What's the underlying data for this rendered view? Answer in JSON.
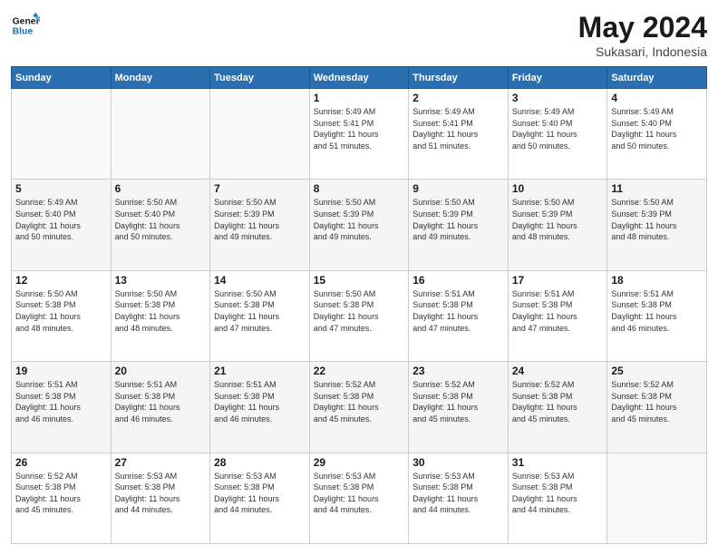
{
  "header": {
    "logo_line1": "General",
    "logo_line2": "Blue",
    "month": "May 2024",
    "location": "Sukasari, Indonesia"
  },
  "weekdays": [
    "Sunday",
    "Monday",
    "Tuesday",
    "Wednesday",
    "Thursday",
    "Friday",
    "Saturday"
  ],
  "weeks": [
    [
      {
        "day": "",
        "info": ""
      },
      {
        "day": "",
        "info": ""
      },
      {
        "day": "",
        "info": ""
      },
      {
        "day": "1",
        "info": "Sunrise: 5:49 AM\nSunset: 5:41 PM\nDaylight: 11 hours\nand 51 minutes."
      },
      {
        "day": "2",
        "info": "Sunrise: 5:49 AM\nSunset: 5:41 PM\nDaylight: 11 hours\nand 51 minutes."
      },
      {
        "day": "3",
        "info": "Sunrise: 5:49 AM\nSunset: 5:40 PM\nDaylight: 11 hours\nand 50 minutes."
      },
      {
        "day": "4",
        "info": "Sunrise: 5:49 AM\nSunset: 5:40 PM\nDaylight: 11 hours\nand 50 minutes."
      }
    ],
    [
      {
        "day": "5",
        "info": "Sunrise: 5:49 AM\nSunset: 5:40 PM\nDaylight: 11 hours\nand 50 minutes."
      },
      {
        "day": "6",
        "info": "Sunrise: 5:50 AM\nSunset: 5:40 PM\nDaylight: 11 hours\nand 50 minutes."
      },
      {
        "day": "7",
        "info": "Sunrise: 5:50 AM\nSunset: 5:39 PM\nDaylight: 11 hours\nand 49 minutes."
      },
      {
        "day": "8",
        "info": "Sunrise: 5:50 AM\nSunset: 5:39 PM\nDaylight: 11 hours\nand 49 minutes."
      },
      {
        "day": "9",
        "info": "Sunrise: 5:50 AM\nSunset: 5:39 PM\nDaylight: 11 hours\nand 49 minutes."
      },
      {
        "day": "10",
        "info": "Sunrise: 5:50 AM\nSunset: 5:39 PM\nDaylight: 11 hours\nand 48 minutes."
      },
      {
        "day": "11",
        "info": "Sunrise: 5:50 AM\nSunset: 5:39 PM\nDaylight: 11 hours\nand 48 minutes."
      }
    ],
    [
      {
        "day": "12",
        "info": "Sunrise: 5:50 AM\nSunset: 5:38 PM\nDaylight: 11 hours\nand 48 minutes."
      },
      {
        "day": "13",
        "info": "Sunrise: 5:50 AM\nSunset: 5:38 PM\nDaylight: 11 hours\nand 48 minutes."
      },
      {
        "day": "14",
        "info": "Sunrise: 5:50 AM\nSunset: 5:38 PM\nDaylight: 11 hours\nand 47 minutes."
      },
      {
        "day": "15",
        "info": "Sunrise: 5:50 AM\nSunset: 5:38 PM\nDaylight: 11 hours\nand 47 minutes."
      },
      {
        "day": "16",
        "info": "Sunrise: 5:51 AM\nSunset: 5:38 PM\nDaylight: 11 hours\nand 47 minutes."
      },
      {
        "day": "17",
        "info": "Sunrise: 5:51 AM\nSunset: 5:38 PM\nDaylight: 11 hours\nand 47 minutes."
      },
      {
        "day": "18",
        "info": "Sunrise: 5:51 AM\nSunset: 5:38 PM\nDaylight: 11 hours\nand 46 minutes."
      }
    ],
    [
      {
        "day": "19",
        "info": "Sunrise: 5:51 AM\nSunset: 5:38 PM\nDaylight: 11 hours\nand 46 minutes."
      },
      {
        "day": "20",
        "info": "Sunrise: 5:51 AM\nSunset: 5:38 PM\nDaylight: 11 hours\nand 46 minutes."
      },
      {
        "day": "21",
        "info": "Sunrise: 5:51 AM\nSunset: 5:38 PM\nDaylight: 11 hours\nand 46 minutes."
      },
      {
        "day": "22",
        "info": "Sunrise: 5:52 AM\nSunset: 5:38 PM\nDaylight: 11 hours\nand 45 minutes."
      },
      {
        "day": "23",
        "info": "Sunrise: 5:52 AM\nSunset: 5:38 PM\nDaylight: 11 hours\nand 45 minutes."
      },
      {
        "day": "24",
        "info": "Sunrise: 5:52 AM\nSunset: 5:38 PM\nDaylight: 11 hours\nand 45 minutes."
      },
      {
        "day": "25",
        "info": "Sunrise: 5:52 AM\nSunset: 5:38 PM\nDaylight: 11 hours\nand 45 minutes."
      }
    ],
    [
      {
        "day": "26",
        "info": "Sunrise: 5:52 AM\nSunset: 5:38 PM\nDaylight: 11 hours\nand 45 minutes."
      },
      {
        "day": "27",
        "info": "Sunrise: 5:53 AM\nSunset: 5:38 PM\nDaylight: 11 hours\nand 44 minutes."
      },
      {
        "day": "28",
        "info": "Sunrise: 5:53 AM\nSunset: 5:38 PM\nDaylight: 11 hours\nand 44 minutes."
      },
      {
        "day": "29",
        "info": "Sunrise: 5:53 AM\nSunset: 5:38 PM\nDaylight: 11 hours\nand 44 minutes."
      },
      {
        "day": "30",
        "info": "Sunrise: 5:53 AM\nSunset: 5:38 PM\nDaylight: 11 hours\nand 44 minutes."
      },
      {
        "day": "31",
        "info": "Sunrise: 5:53 AM\nSunset: 5:38 PM\nDaylight: 11 hours\nand 44 minutes."
      },
      {
        "day": "",
        "info": ""
      }
    ]
  ]
}
